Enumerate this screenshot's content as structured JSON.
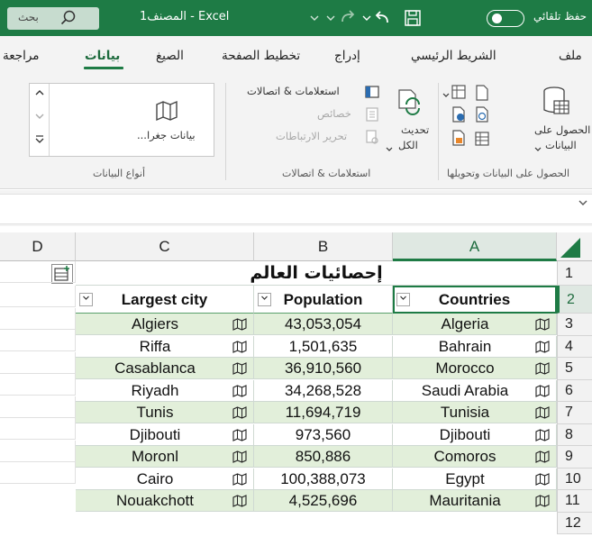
{
  "titlebar": {
    "search_label": "بحث",
    "title": "Excel - المصنف1",
    "autosave_label": "حفظ تلقائي"
  },
  "tabs": [
    {
      "label": "مراجعة",
      "active": false
    },
    {
      "label": "بيانات",
      "active": true
    },
    {
      "label": "الصيغ",
      "active": false
    },
    {
      "label": "تخطيط الصفحة",
      "active": false
    },
    {
      "label": "إدراج",
      "active": false
    },
    {
      "label": "الشريط الرئيسي",
      "active": false
    },
    {
      "label": "ملف",
      "active": false
    }
  ],
  "ribbon": {
    "get_data": {
      "line1": "الحصول على",
      "line2": "البيانات"
    },
    "group_get_transform": "الحصول على البيانات وتحويلها",
    "refresh": {
      "line1": "تحديث",
      "line2": "الكل"
    },
    "queries_connections": "استعلامات & اتصالات",
    "properties": "خصائص",
    "edit_links": "تحرير الارتباطات",
    "group_queries": "استعلامات & اتصالات",
    "geography": "بيانات جغرا...",
    "group_data_types": "أنواع البيانات"
  },
  "grid": {
    "columns": [
      "D",
      "C",
      "B",
      "A"
    ],
    "selected_column": "A",
    "row_numbers": [
      "1",
      "2",
      "3",
      "4",
      "5",
      "6",
      "7",
      "8",
      "9",
      "10",
      "11",
      "12"
    ],
    "title": "إحصائيات العالم",
    "headers": {
      "city": "Largest city",
      "population": "Population",
      "country": "Countries"
    },
    "rows": [
      {
        "city": "Algiers",
        "population": "43,053,054",
        "country": "Algeria"
      },
      {
        "city": "Riffa",
        "population": "1,501,635",
        "country": "Bahrain"
      },
      {
        "city": "Casablanca",
        "population": "36,910,560",
        "country": "Morocco"
      },
      {
        "city": "Riyadh",
        "population": "34,268,528",
        "country": "Saudi Arabia"
      },
      {
        "city": "Tunis",
        "population": "11,694,719",
        "country": "Tunisia"
      },
      {
        "city": "Djibouti",
        "population": "973,560",
        "country": "Djibouti"
      },
      {
        "city": "Moronl",
        "population": "850,886",
        "country": "Comoros"
      },
      {
        "city": "Cairo",
        "population": "100,388,073",
        "country": "Egypt"
      },
      {
        "city": "Nouakchott",
        "population": "4,525,696",
        "country": "Mauritania"
      }
    ]
  },
  "colors": {
    "accent": "#1e7b45",
    "band": "#e2efda",
    "title_bar": "#1e7b45"
  },
  "icons": [
    "search-icon",
    "undo-icon",
    "redo-icon",
    "save-icon",
    "map-icon",
    "filter-dropdown-icon",
    "quick-analysis-icon"
  ]
}
